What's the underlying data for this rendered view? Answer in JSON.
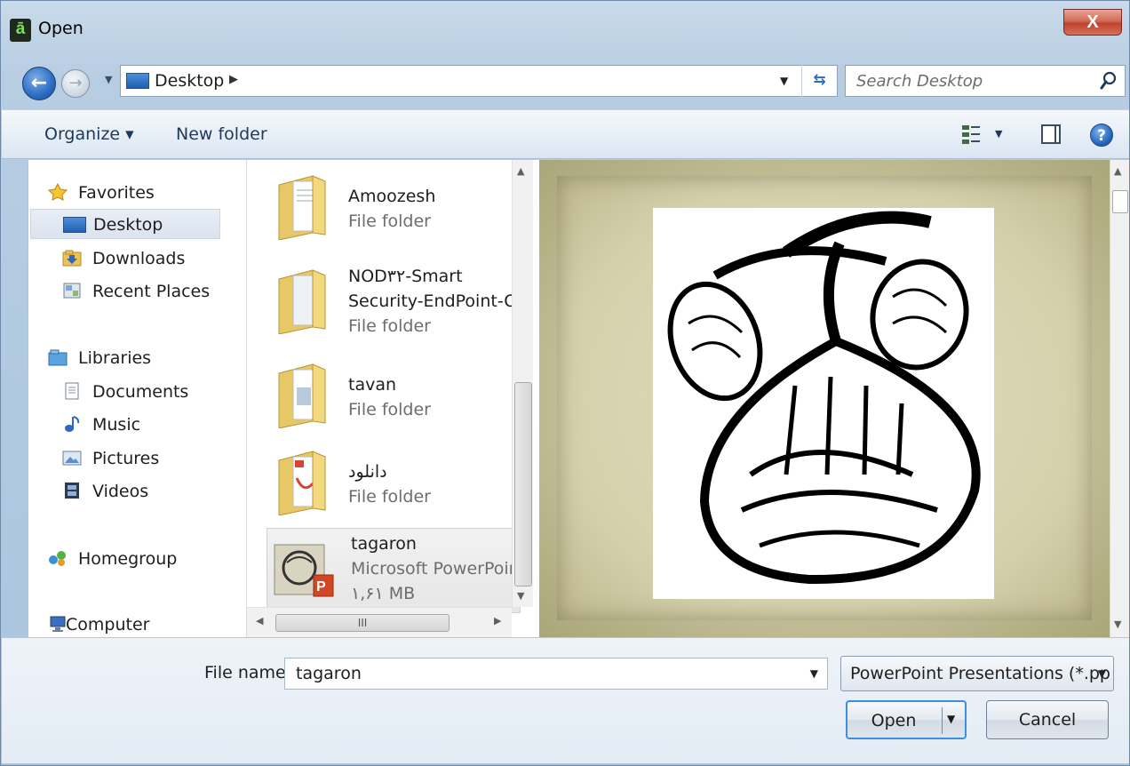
{
  "window": {
    "title": "Open",
    "app_icon_glyph": "ā",
    "close_glyph": "X"
  },
  "nav": {
    "address": "Desktop",
    "search_placeholder": "Search Desktop"
  },
  "toolbar": {
    "organize_label": "Organize ▾",
    "new_folder_label": "New folder",
    "help_glyph": "?"
  },
  "sidebar": {
    "favorites": {
      "label": "Favorites",
      "icon": "star-icon"
    },
    "favorite_items": [
      {
        "label": "Desktop",
        "icon": "desktop-icon",
        "selected": true
      },
      {
        "label": "Downloads",
        "icon": "downloads-folder-icon"
      },
      {
        "label": "Recent Places",
        "icon": "recent-places-icon"
      }
    ],
    "libraries": {
      "label": "Libraries",
      "icon": "libraries-icon"
    },
    "library_items": [
      {
        "label": "Documents",
        "icon": "documents-icon"
      },
      {
        "label": "Music",
        "icon": "music-icon"
      },
      {
        "label": "Pictures",
        "icon": "pictures-icon"
      },
      {
        "label": "Videos",
        "icon": "videos-icon"
      }
    ],
    "homegroup": {
      "label": "Homegroup",
      "icon": "homegroup-icon"
    },
    "computer": {
      "label": "Computer",
      "icon": "computer-icon"
    }
  },
  "files": [
    {
      "name": "Amoozesh",
      "type": "File folder",
      "icon": "folder-icon"
    },
    {
      "name": "NOD۳۲-Smart",
      "name2": "Security-EndPoint-Of",
      "type": "File folder",
      "icon": "folder-icon"
    },
    {
      "name": "tavan",
      "type": "File folder",
      "icon": "folder-icon"
    },
    {
      "name": "دانلود",
      "type": "File folder",
      "icon": "folder-icon"
    },
    {
      "name": "tagaron",
      "type": "Microsoft PowerPoint",
      "size": "۱,۶۱ MB",
      "icon": "powerpoint-file-icon",
      "selected": true
    }
  ],
  "preview": {
    "description_icon": "calligraphy-preview-image"
  },
  "bottom": {
    "filename_label": "File name:",
    "filename_value": "tagaron",
    "filetype_value": "PowerPoint Presentations (*.pp",
    "open_label": "Open",
    "cancel_label": "Cancel"
  },
  "colors": {
    "accent": "#3d8ee0",
    "close": "#c0432b",
    "frame": "#aac4de"
  }
}
